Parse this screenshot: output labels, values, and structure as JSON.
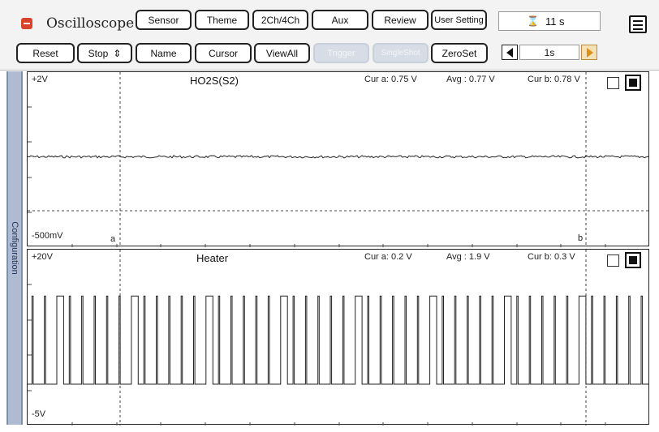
{
  "app": {
    "title": "Oscilloscope"
  },
  "toolbar1": {
    "sensor": "Sensor",
    "theme": "Theme",
    "channels": "2Ch/4Ch",
    "aux": "Aux",
    "review": "Review",
    "user_setting": "User Setting",
    "record_time": "11 s"
  },
  "toolbar2": {
    "reset": "Reset",
    "stop": "Stop",
    "stop_arrows": "⇕",
    "name": "Name",
    "cursor": "Cursor",
    "view_all": "ViewAll",
    "trigger": "Trigger",
    "single_shot": "SingleShot",
    "zero_set": "ZeroSet",
    "timebase": "1s"
  },
  "sidebar": {
    "label": "Configuration"
  },
  "channel1": {
    "name": "HO2S(S2)",
    "top_scale": "+2V",
    "bottom_scale": "-500mV",
    "cur_a": "Cur a: 0.75 V",
    "avg": "Avg  : 0.77 V",
    "cur_b": "Cur b: 0.78 V",
    "marker_a": "a",
    "marker_b": "b"
  },
  "channel2": {
    "name": "Heater",
    "top_scale": "+20V",
    "bottom_scale": "-5V",
    "cur_a": "Cur a: 0.2 V",
    "avg": "Avg  : 1.9 V",
    "cur_b": "Cur b: 0.3 V"
  },
  "chart_data": [
    {
      "type": "line",
      "title": "HO2S(S2)",
      "ylim": [
        -0.5,
        2
      ],
      "series": [
        {
          "name": "HO2S(S2)",
          "mean_value": 0.77,
          "shape": "flat with small noise"
        }
      ]
    },
    {
      "type": "line",
      "title": "Heater",
      "ylim": [
        -5,
        20
      ],
      "series": [
        {
          "name": "Heater",
          "low_value": 0.2,
          "high_value": 14,
          "shape": "pulse train",
          "pulse_count": 50
        }
      ]
    }
  ]
}
